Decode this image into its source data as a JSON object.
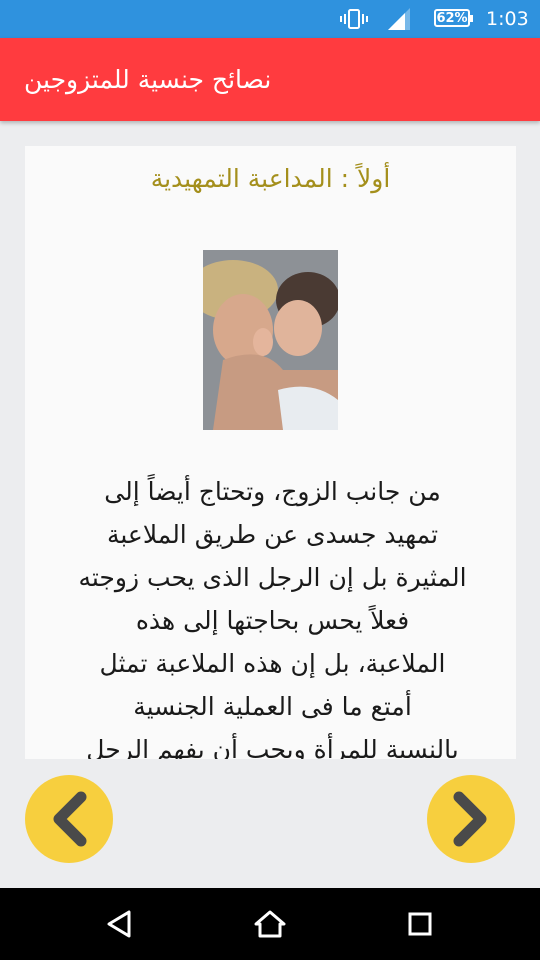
{
  "status_bar": {
    "battery": "62%",
    "time": "1:03",
    "icons": [
      "vibrate-icon",
      "signal-icon",
      "battery-icon"
    ]
  },
  "app_bar": {
    "title": "نصائح جنسية للمتزوجين",
    "color": "#ff3b3f"
  },
  "content": {
    "heading": "أولاً : المداعبة التمهيدية",
    "heading_color": "#a48f1c",
    "image_icon": "couple-photo",
    "body": "من جانب الزوج، وتحتاج أيضاً إلى\nتمهيد جسدى عن طريق الملاعبة\nالمثيرة بل إن الرجل الذى يحب زوجته\nفعلاً يحس بحاجتها إلى هذه\nالملاعبة، بل إن هذه الملاعبة تمثل\nأمتع ما فى العملية الجنسية\nبالنسبة للمرأة ويجب أن يفهم الرجل"
  },
  "navigation": {
    "prev_icon": "chevron-left-icon",
    "next_icon": "chevron-right-icon",
    "button_color": "#f7cf3e"
  },
  "system_nav": {
    "icons": [
      "back-icon",
      "home-icon",
      "recents-icon"
    ]
  }
}
